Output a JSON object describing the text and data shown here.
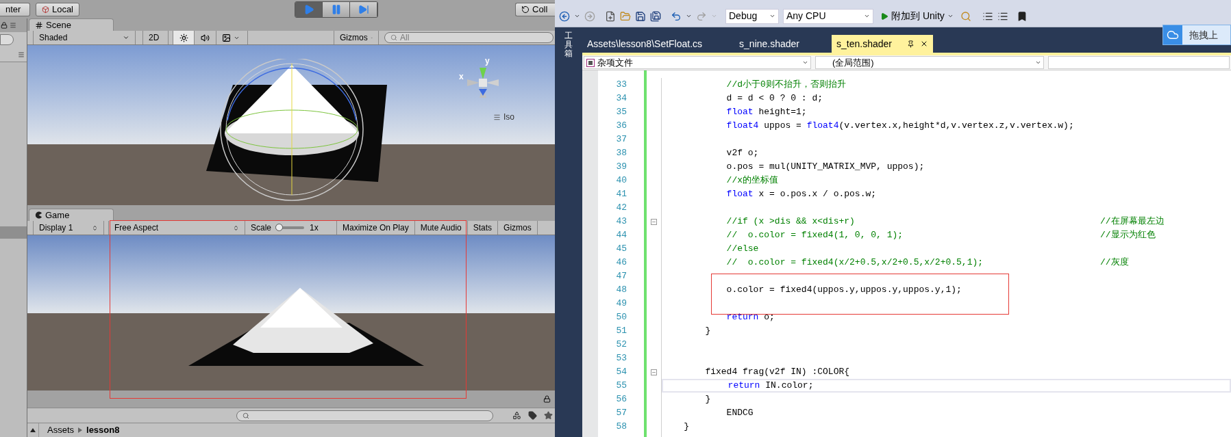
{
  "unity": {
    "toolbar": {
      "pivot": "nter",
      "space": "Local",
      "collab": "Coll"
    },
    "play_controls": [
      {
        "kind": "play",
        "selected": true
      },
      {
        "kind": "pause",
        "selected": false
      },
      {
        "kind": "step",
        "selected": false
      }
    ],
    "scene": {
      "tab": "Scene",
      "shading": "Shaded",
      "mode_2d": "2D",
      "lighting": true,
      "audio": false,
      "gizmos": "Gizmos",
      "search": {
        "placeholder": "All"
      },
      "axis_labels": [
        "y",
        "x"
      ],
      "projection": "Iso"
    },
    "game": {
      "tab": "Game",
      "display": "Display 1",
      "aspect": "Free Aspect",
      "scale": {
        "label": "Scale",
        "level": 0.04,
        "reading": "1x"
      },
      "toggles": [
        "Maximize On Play",
        "Mute Audio",
        "Stats",
        "Gizmos"
      ]
    },
    "project": {
      "breadcrumb": [
        {
          "label": "Assets"
        },
        {
          "label": "lesson8"
        }
      ]
    }
  },
  "vs": {
    "toolbar": {
      "configuration": "Debug",
      "platform": "Any CPU",
      "start": "附加到 Unity"
    },
    "toolbox": "工具箱",
    "tabs": [
      {
        "label": "Assets\\lesson8\\SetFloat.cs",
        "selected": false
      },
      {
        "label": "s_nine.shader",
        "selected": false
      },
      {
        "label": "s_ten.shader",
        "selected": true
      }
    ],
    "popup": "拖拽上",
    "nav": {
      "project": "杂项文件",
      "scope": "(全局范围)"
    },
    "lines": [
      {
        "number": "33",
        "fold": false,
        "current": false,
        "code": [
          {
            "kind": "comment",
            "text": "            //d小于0则不抬升，否则抬升"
          }
        ]
      },
      {
        "number": "34",
        "fold": false,
        "current": false,
        "code": [
          {
            "kind": "plain",
            "text": "            d = d < 0 ? 0 : d;"
          }
        ]
      },
      {
        "number": "35",
        "fold": false,
        "current": false,
        "code": [
          {
            "kind": "keyword",
            "text": "            float"
          },
          {
            "kind": "plain",
            "text": " height=1;"
          }
        ]
      },
      {
        "number": "36",
        "fold": false,
        "current": false,
        "code": [
          {
            "kind": "keyword",
            "text": "            float4"
          },
          {
            "kind": "plain",
            "text": " uppos = "
          },
          {
            "kind": "keyword",
            "text": "float4"
          },
          {
            "kind": "plain",
            "text": "(v.vertex.x,height*d,v.vertex.z,v.vertex.w);"
          }
        ]
      },
      {
        "number": "37",
        "fold": false,
        "current": false
      },
      {
        "number": "38",
        "fold": false,
        "current": false,
        "code": [
          {
            "kind": "plain",
            "text": "            v2f o;"
          }
        ]
      },
      {
        "number": "39",
        "fold": false,
        "current": false,
        "code": [
          {
            "kind": "plain",
            "text": "            o.pos = mul(UNITY_MATRIX_MVP, uppos);"
          }
        ]
      },
      {
        "number": "40",
        "fold": false,
        "current": false,
        "code": [
          {
            "kind": "comment",
            "text": "            //x的坐标值"
          }
        ]
      },
      {
        "number": "41",
        "fold": false,
        "current": false,
        "code": [
          {
            "kind": "keyword",
            "text": "            float"
          },
          {
            "kind": "plain",
            "text": " x = o.pos.x / o.pos.w;"
          }
        ]
      },
      {
        "number": "42",
        "fold": false,
        "current": false
      },
      {
        "number": "43",
        "fold": true,
        "current": false,
        "code": [
          {
            "kind": "comment",
            "text": "            //if (x >dis && x<dis+r)"
          }
        ],
        "note": "//在屏幕最左边"
      },
      {
        "number": "44",
        "fold": false,
        "current": false,
        "code": [
          {
            "kind": "comment",
            "text": "            //  o.color = fixed4(1, 0, 0, 1);"
          }
        ],
        "note": "//显示为红色"
      },
      {
        "number": "45",
        "fold": false,
        "current": false,
        "code": [
          {
            "kind": "comment",
            "text": "            //else"
          }
        ]
      },
      {
        "number": "46",
        "fold": false,
        "current": false,
        "code": [
          {
            "kind": "comment",
            "text": "            //  o.color = fixed4(x/2+0.5,x/2+0.5,x/2+0.5,1);"
          }
        ],
        "note": "//灰度"
      },
      {
        "number": "47",
        "fold": false,
        "current": false
      },
      {
        "number": "48",
        "fold": false,
        "current": false,
        "code": [
          {
            "kind": "plain",
            "text": "            o.color = fixed4(uppos.y,uppos.y,uppos.y,1);"
          }
        ]
      },
      {
        "number": "49",
        "fold": false,
        "current": false
      },
      {
        "number": "50",
        "fold": false,
        "current": false,
        "code": [
          {
            "kind": "keyword",
            "text": "            return"
          },
          {
            "kind": "plain",
            "text": " o;"
          }
        ]
      },
      {
        "number": "51",
        "fold": false,
        "current": false,
        "code": [
          {
            "kind": "plain",
            "text": "        }"
          }
        ]
      },
      {
        "number": "52",
        "fold": false,
        "current": false
      },
      {
        "number": "53",
        "fold": false,
        "current": false
      },
      {
        "number": "54",
        "fold": true,
        "current": false,
        "code": [
          {
            "kind": "plain",
            "text": "        fixed4 frag(v2f IN) :COLOR{"
          }
        ]
      },
      {
        "number": "55",
        "fold": false,
        "current": true,
        "code": [
          {
            "kind": "keyword",
            "text": "            return"
          },
          {
            "kind": "plain",
            "text": " IN.color;"
          }
        ]
      },
      {
        "number": "56",
        "fold": false,
        "current": false,
        "code": [
          {
            "kind": "plain",
            "text": "        }"
          }
        ]
      },
      {
        "number": "57",
        "fold": false,
        "current": false,
        "code": [
          {
            "kind": "plain",
            "text": "            ENDCG"
          }
        ]
      },
      {
        "number": "58",
        "fold": false,
        "current": false,
        "code": [
          {
            "kind": "plain",
            "text": "    }"
          }
        ]
      }
    ]
  }
}
